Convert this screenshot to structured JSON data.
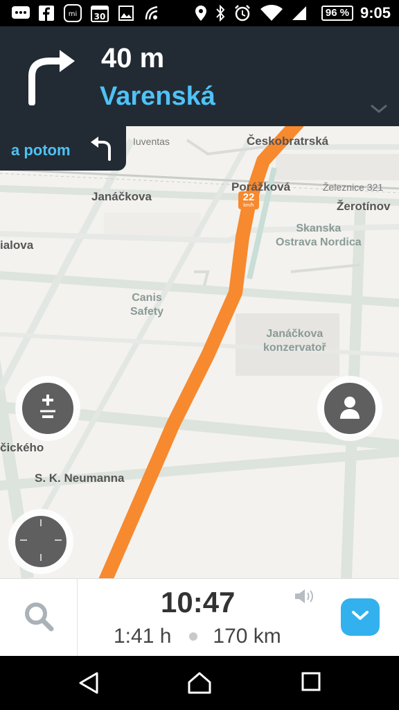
{
  "status_bar": {
    "time": "9:05",
    "battery": "96 %",
    "icons": [
      "message-icon",
      "facebook-icon",
      "mi-icon",
      "calendar-icon",
      "gallery-icon",
      "nfc-icon",
      "location-icon",
      "bluetooth-icon",
      "alarm-icon",
      "wifi-icon",
      "signal-icon"
    ],
    "calendar_day": "30"
  },
  "navigation": {
    "distance": "40 m",
    "street": "Varenská",
    "then_label": "a potom",
    "turn_icon": "turn-right-icon",
    "then_icon": "turn-left-icon"
  },
  "map": {
    "labels": {
      "ceskobratrska": "Českobratrská",
      "iuventas": "Iuventas",
      "porazkova": "Porážková",
      "zeleznice": "Železnice 321",
      "janackova": "Janáčkova",
      "zerotinova": "Žerotínov",
      "ialova": "ialova",
      "skanska": "Skanska\nOstrava Nordica",
      "canis": "Canis\nSafety",
      "konzervator": "Janáčkova\nkonzervatoř",
      "cickeho": "čického",
      "neumanna": "S. K. Neumanna"
    },
    "speed_limit": "22",
    "speed_unit": "km/h"
  },
  "bottom": {
    "eta": "10:47",
    "duration": "1:41 h",
    "distance": "170 km"
  },
  "colors": {
    "header_bg": "#222b33",
    "accent_blue": "#4ec2f7",
    "route_orange": "#f7892f",
    "menu_blue": "#33b1ee"
  }
}
